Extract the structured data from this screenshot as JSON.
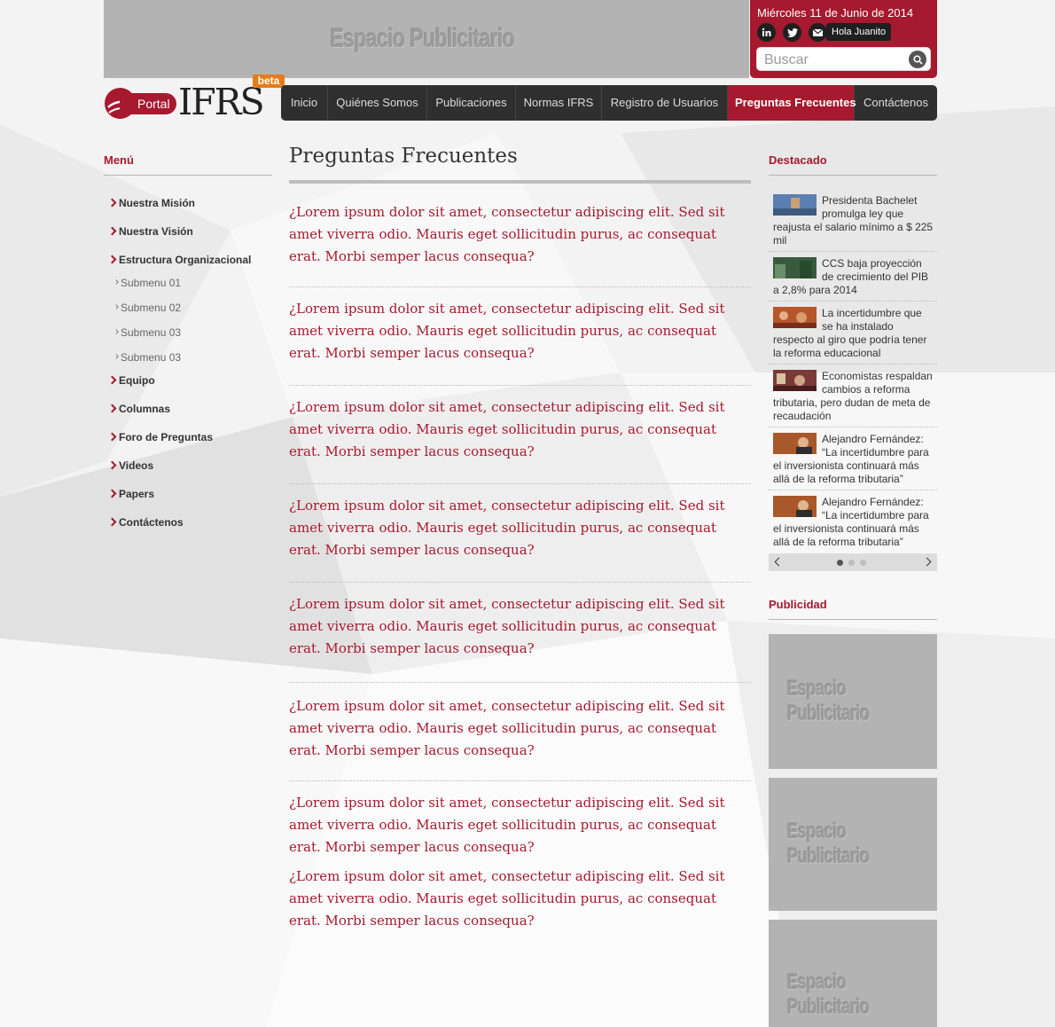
{
  "top_ad": {
    "label": "Espacio Publicitario"
  },
  "header": {
    "date": "Miércoles 11 de Junio de 2014",
    "social_icons": [
      "linkedin-icon",
      "twitter-icon",
      "email-icon"
    ],
    "user_greeting": "Hola Juanito",
    "search_placeholder": "Buscar"
  },
  "logo": {
    "portal": "Portal",
    "brand": "IFRS",
    "badge": "beta"
  },
  "nav": {
    "items": [
      {
        "label": "Inicio"
      },
      {
        "label": "Quiénes Somos"
      },
      {
        "label": "Publicaciones"
      },
      {
        "label": "Normas IFRS"
      },
      {
        "label": "Registro de Usuarios"
      },
      {
        "label": "Preguntas Frecuentes",
        "active": true
      },
      {
        "label": "Contáctenos"
      }
    ]
  },
  "sidebar": {
    "title": "Menú",
    "items": [
      "Nuestra Misión",
      "Nuestra Visión",
      "Estructura Organizacional",
      "Submenu 01",
      "Submenu 02",
      "Submenu 03",
      "Submenu 03",
      "Equipo",
      "Columnas",
      "Foro de Preguntas",
      "Videos",
      "Papers",
      "Contáctenos"
    ]
  },
  "main": {
    "title": "Preguntas Frecuentes",
    "faqs": [
      "¿Lorem ipsum dolor sit amet, consectetur adipiscing elit. Sed sit amet viverra odio. Mauris eget sollicitudin purus, ac consequat erat. Morbi semper lacus consequa?",
      "¿Lorem ipsum dolor sit amet, consectetur adipiscing elit. Sed sit amet viverra odio. Mauris eget sollicitudin purus, ac consequat erat. Morbi semper lacus consequa?",
      "¿Lorem ipsum dolor sit amet, consectetur adipiscing elit. Sed sit amet viverra odio. Mauris eget sollicitudin purus, ac consequat erat. Morbi semper lacus consequa?",
      "¿Lorem ipsum dolor sit amet, consectetur adipiscing elit. Sed sit amet viverra odio. Mauris eget sollicitudin purus, ac consequat erat. Morbi semper lacus consequa?",
      "¿Lorem ipsum dolor sit amet, consectetur adipiscing elit. Sed sit amet viverra odio. Mauris eget sollicitudin purus, ac consequat erat. Morbi semper lacus consequa?",
      "¿Lorem ipsum dolor sit amet, consectetur adipiscing elit. Sed sit amet viverra odio. Mauris eget sollicitudin purus, ac consequat erat. Morbi semper lacus consequa?",
      "¿Lorem ipsum dolor sit amet, consectetur adipiscing elit. Sed sit amet viverra odio. Mauris eget sollicitudin purus, ac consequat erat. Morbi semper lacus consequa?",
      "¿Lorem ipsum dolor sit amet, consectetur adipiscing elit. Sed sit amet viverra odio. Mauris eget sollicitudin purus, ac consequat erat. Morbi semper lacus consequa?"
    ]
  },
  "featured": {
    "title": "Destacado",
    "items": [
      "Presidenta Bachelet promulga ley que reajusta el salario mínimo a $ 225 mil",
      "CCS baja proyección de crecimiento del PIB a 2,8% para 2014",
      "La incertidumbre que se ha instalado respecto al giro que podría tener la reforma educacional",
      "Economistas respaldan cambios a reforma tributaria, pero dudan de meta de recaudación",
      "Alejandro Fernández: “La incertidumbre para el inversionista continuará más allá de la reforma tributaria”",
      "Alejandro Fernández: “La incertidumbre para el inversionista continuará más allá de la reforma tributaria”"
    ],
    "slider_pages": 3,
    "slider_active": 1
  },
  "advertising": {
    "title": "Publicidad",
    "slots": [
      "Espacio Publicitario",
      "Espacio Publicitario",
      "Espacio Publicitario"
    ]
  },
  "colors": {
    "brand_red": "#a6192e",
    "nav_dark": "#2f2f2f",
    "ad_gray": "#b3b3b3",
    "beta_orange": "#e57c1b"
  }
}
